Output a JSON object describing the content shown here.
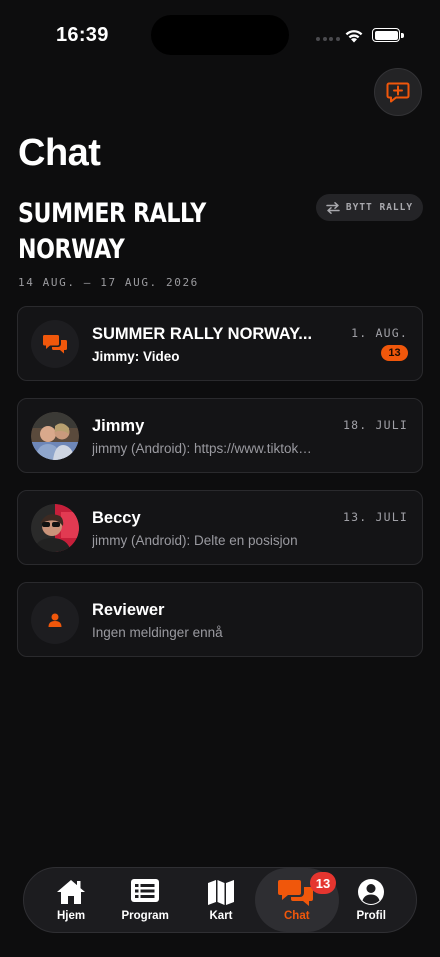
{
  "status_bar": {
    "time": "16:39"
  },
  "header": {
    "title": "Chat",
    "new_chat_icon": "chat-plus-icon"
  },
  "rally": {
    "name": "SUMMER RALLY NORWAY",
    "dates": "14 AUG. — 17 AUG. 2026",
    "switch_label": "BYTT RALLY"
  },
  "chats": [
    {
      "name": "SUMMER RALLY NORWAY...",
      "preview": "Jimmy: Video",
      "date": "1. AUG.",
      "unread": "13",
      "avatar": "group-chat-icon"
    },
    {
      "name": "Jimmy",
      "preview": "jimmy (Android): https://www.tiktok.com",
      "date": "18. JULI",
      "avatar": "photo"
    },
    {
      "name": "Beccy",
      "preview": "jimmy (Android): Delte en posisjon",
      "date": "13. JULI",
      "avatar": "photo"
    },
    {
      "name": "Reviewer",
      "preview": "Ingen meldinger ennå",
      "date": "",
      "avatar": "person-icon"
    }
  ],
  "tabbar": {
    "items": [
      {
        "label": "Hjem",
        "icon": "home-icon"
      },
      {
        "label": "Program",
        "icon": "list-icon"
      },
      {
        "label": "Kart",
        "icon": "map-icon"
      },
      {
        "label": "Chat",
        "icon": "chat-icon",
        "active": true
      },
      {
        "label": "Profil",
        "icon": "profile-icon"
      }
    ],
    "chat_badge": "13"
  },
  "colors": {
    "accent": "#f0570b",
    "background": "#0d0d0e",
    "card": "#141416",
    "badge_red": "#e5352f"
  }
}
